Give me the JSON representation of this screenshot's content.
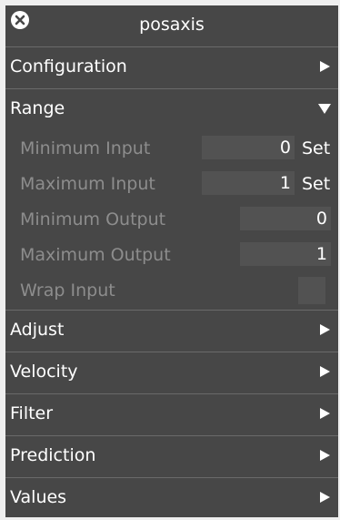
{
  "window": {
    "title": "posaxis"
  },
  "icons": {
    "close": "close-icon",
    "collapsed": "triangle-right-icon",
    "expanded": "triangle-down-icon"
  },
  "colors": {
    "panel_bg": "#474747",
    "field_bg": "#525252",
    "disabled_text": "#8d8d8d",
    "text": "#ffffff",
    "page_bg": "#efefef"
  },
  "sections": {
    "configuration": {
      "label": "Configuration",
      "expanded": false
    },
    "range": {
      "label": "Range",
      "expanded": true
    },
    "adjust": {
      "label": "Adjust",
      "expanded": false
    },
    "velocity": {
      "label": "Velocity",
      "expanded": false
    },
    "filter": {
      "label": "Filter",
      "expanded": false
    },
    "prediction": {
      "label": "Prediction",
      "expanded": false
    },
    "values": {
      "label": "Values",
      "expanded": false
    }
  },
  "range": {
    "minimum_input": {
      "label": "Minimum Input",
      "value": "0",
      "set_label": "Set"
    },
    "maximum_input": {
      "label": "Maximum Input",
      "value": "1",
      "set_label": "Set"
    },
    "minimum_output": {
      "label": "Minimum Output",
      "value": "0"
    },
    "maximum_output": {
      "label": "Maximum Output",
      "value": "1"
    },
    "wrap_input": {
      "label": "Wrap Input",
      "checked": false
    }
  }
}
